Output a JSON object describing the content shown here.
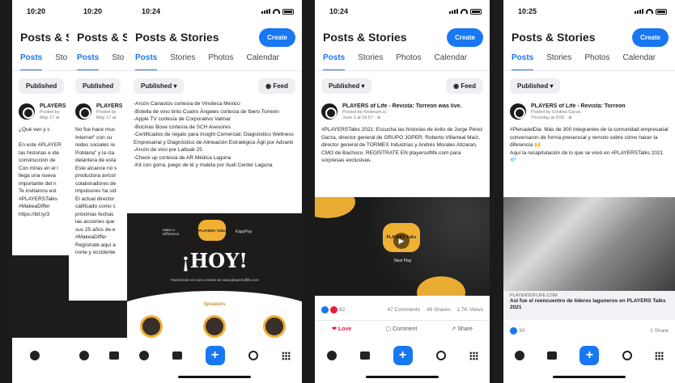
{
  "app": {
    "title": "Posts & Stories",
    "create": "Create",
    "tabs": [
      "Posts",
      "Stories",
      "Photos",
      "Calendar"
    ],
    "published": "Published",
    "feed": "Feed"
  },
  "shots": [
    {
      "time": "10:20",
      "title_clip": "Posts & S",
      "tab_posts": "Posts",
      "tab_stories_clip": "Sto",
      "post_name": "PLAYERS",
      "post_meta1": "Posted by",
      "post_meta2": "May 17 at",
      "text": "¿Qué ven y c\n\nEn este #PLAYER\nlas historias e ide\nconstrucción de\nCon miras en el l\nllega una nueva\nimportante del n\nTe invitamos est\n#PLAYERSTalks\n#MakeaDiffer\nhttps://bit.ly/3"
    },
    {
      "time": "10:20",
      "title_clip": "Posts & S",
      "tab_posts": "Posts",
      "tab_stories_clip": "Sto",
      "post_name": "PLAYERS",
      "post_meta1": "Posted by",
      "post_meta2": "May 17 at",
      "text": "No fue hace muc\nInternet\" con su\nredes sociales re\nPoblana\" y la cla\ndelantera de esta\nEste alcance no s\nproductora avícol\ncolaboradores de\nimpulsores ha sid\nEl actual director\ncalificado como c\npróximas fechas\nlas acciones que\nsus 25 años de e\n#MakeaDiffer\nRegístrate aquí a\nnorte y occidente"
    },
    {
      "time": "10:24",
      "text": "-Arcón Canastos cortesía de Vinoteca Mexico\n-Botella de vino tinto Cuatro Ángeles cortesía de Ibero Torreón\n-Apple TV cortesía de Corporativo Valmar\n-Bocinas Bose cortesía de SCH Asesores\n-Certificados de regalo para Insight Comercial, Diagnóstico Wellness Empresarial y Diagnóstico de Alineación Estratégica Ágil por Advanti\n-Arcón de vino por Lattuali 25\n-Check up cortesía de AR Médica Laguna\n-Kit con gorra, juego de té y maleta por Audi Center Laguna",
      "flyer_brand_left": "Make a Difference",
      "flyer_brand_right": "KappPay",
      "flyer_players": "PLAYERS Talks",
      "flyer_headline": "¡HOY!",
      "flyer_sub": "Transmisión en vivo a través de www.playersoflife.com",
      "flyer_speakers": "Speakers"
    },
    {
      "time": "10:24",
      "post_name": "PLAYERS of Life - Revista: Torreon was live.",
      "post_meta1": "Posted by Redream.io",
      "post_meta2": "June 3 at 16:57 · ⊕",
      "text": "#PLAYERSTalks 2021: Escucha las historias de éxito de Jorge Pérez Garza, director general de GRUPO JOPER; Roberto Villarreal Maíz, director general de TORMEX Industrias y Andrés Morales Atizaran, CMO de Bachoco. REGÍSTRATE EN playersoflife.com para sorpresas exclusivas.",
      "video_label": "PLAYERS Talks",
      "video_sub": "Next Play",
      "reactions": "62",
      "comments": "47 Comments",
      "shares": "48 Shares",
      "views": "1.7K Views",
      "love": "Love",
      "comment": "Comment",
      "share": "Share"
    },
    {
      "time": "10:25",
      "post_name": "PLAYERS of Life - Revista: Torreon",
      "post_meta1": "Posted by Cristina Garza",
      "post_meta2": "Thursday at 9:00 · ⊕",
      "text": "#PlenadelDia: Más de 300 integrantes de la comunidad empresarial conversaron de forma presencial y remoto sobre cómo hacer la diferencia 🙌\nAquí la recapitulación de lo que se vivió en #PLAYERSTalks 2021 💎",
      "link_domain": "PLAYERSOFLIFE.COM",
      "link_title": "Así fue el reencuentro de líderes laguneros en PLAYERS Talks 2021",
      "reactions": "30",
      "shares": "1 Share"
    }
  ],
  "colors": {
    "accent": "#1877f2",
    "love": "#e41e3f",
    "chip": "#eeeff2"
  }
}
